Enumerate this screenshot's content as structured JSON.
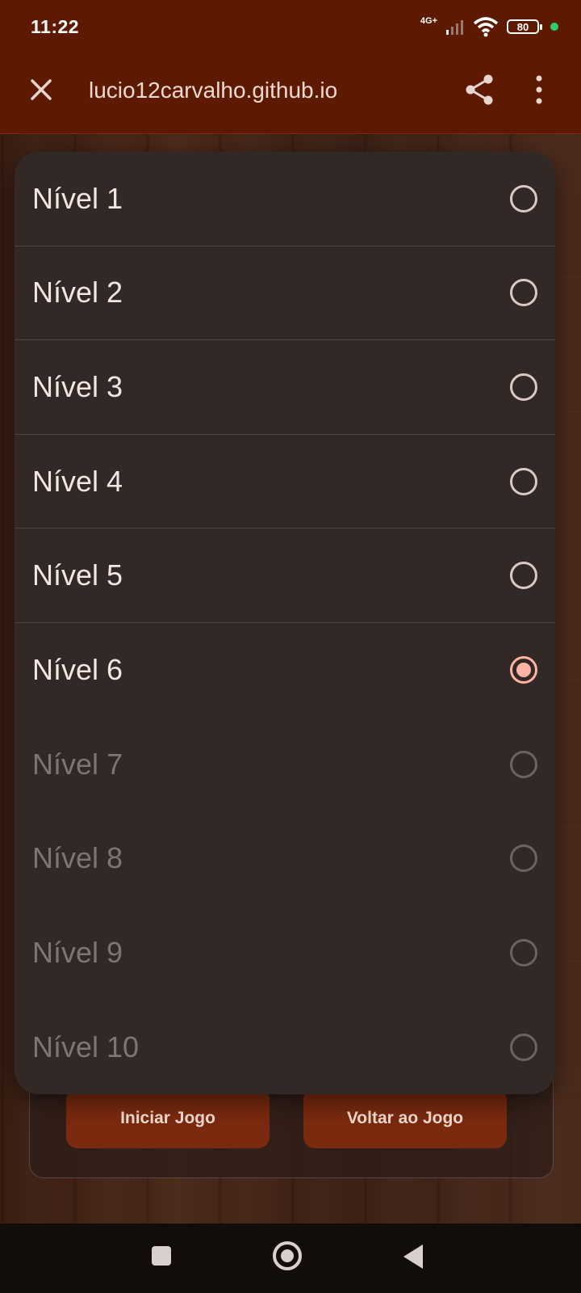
{
  "status": {
    "time": "11:22",
    "network": "4G+",
    "battery": "80"
  },
  "browser": {
    "url": "lucio12carvalho.github.io",
    "icons": [
      "close-icon",
      "share-icon",
      "more-vert-icon"
    ]
  },
  "levels": [
    {
      "label": "Nível 1",
      "selected": false,
      "enabled": true
    },
    {
      "label": "Nível 2",
      "selected": false,
      "enabled": true
    },
    {
      "label": "Nível 3",
      "selected": false,
      "enabled": true
    },
    {
      "label": "Nível 4",
      "selected": false,
      "enabled": true
    },
    {
      "label": "Nível 5",
      "selected": false,
      "enabled": true
    },
    {
      "label": "Nível 6",
      "selected": true,
      "enabled": true
    },
    {
      "label": "Nível 7",
      "selected": false,
      "enabled": false
    },
    {
      "label": "Nível 8",
      "selected": false,
      "enabled": false
    },
    {
      "label": "Nível 9",
      "selected": false,
      "enabled": false
    },
    {
      "label": "Nível 10",
      "selected": false,
      "enabled": false
    }
  ],
  "game": {
    "start_label": "Iniciar Jogo",
    "back_label": "Voltar ao Jogo"
  },
  "colors": {
    "toolbar": "#5e1a00",
    "dialog": "#322927",
    "accent": "#ffb4a2",
    "button": "#7a2a0f"
  }
}
